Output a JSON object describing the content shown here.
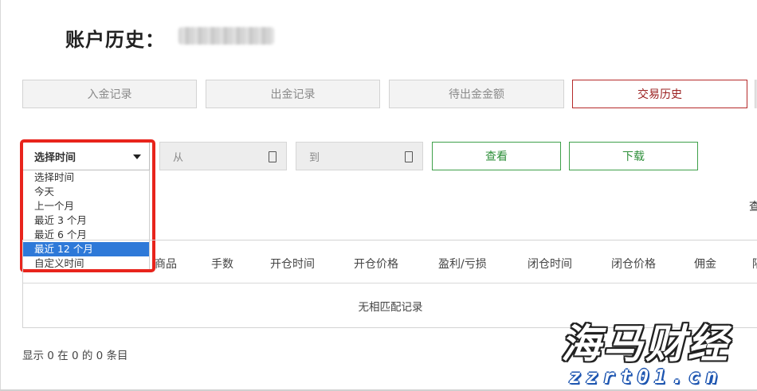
{
  "header": {
    "title": "账户历史："
  },
  "tabs": [
    {
      "label": "入金记录",
      "active": false
    },
    {
      "label": "出金记录",
      "active": false
    },
    {
      "label": "待出金金额",
      "active": false
    },
    {
      "label": "交易历史",
      "active": true
    }
  ],
  "filters": {
    "period_select": {
      "value": "选择时间",
      "options": [
        "选择时间",
        "今天",
        "上一个月",
        "最近 3 个月",
        "最近 6 个月",
        "最近 12 个月",
        "自定义时间"
      ],
      "highlighted_option": "最近 12 个月"
    },
    "from_placeholder": "从",
    "to_placeholder": "到",
    "view_label": "查看",
    "download_label": "下载"
  },
  "truncated_right_text": "查",
  "table": {
    "columns": [
      "商品",
      "手数",
      "开仓时间",
      "开仓价格",
      "盈利/亏损",
      "闭仓时间",
      "闭仓价格",
      "佣金",
      "隔"
    ],
    "empty_message": "无相匹配记录"
  },
  "pagination": {
    "summary": "显示 0 在 0 的 0 条目"
  },
  "watermark": {
    "brand": "海马财经",
    "url": "zzrt01.cn"
  },
  "colors": {
    "active_tab": "#b52a2a",
    "green_button": "#3fa04a",
    "highlight_border": "#e8241c",
    "selected_option": "#2e79d8"
  }
}
